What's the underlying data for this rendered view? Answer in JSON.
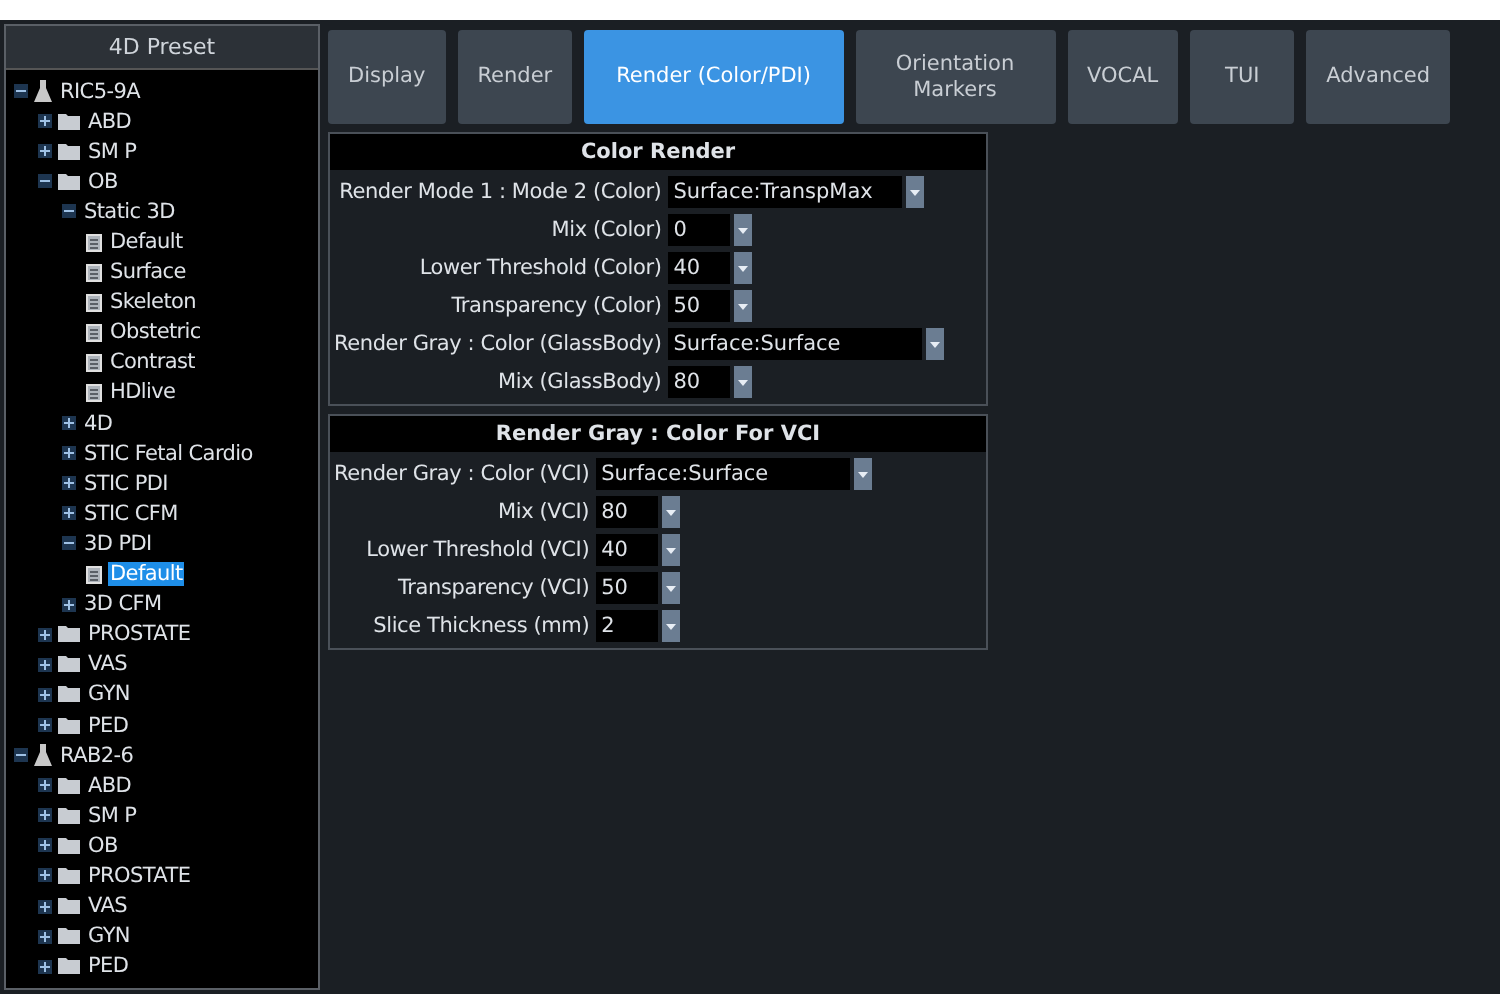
{
  "tree": {
    "title": "4D Preset",
    "items": [
      {
        "label": "RIC5-9A",
        "kind": "probe",
        "expanded": true,
        "selected": false,
        "children": [
          {
            "label": "ABD",
            "kind": "folder",
            "expanded": false,
            "selected": false
          },
          {
            "label": "SM P",
            "kind": "folder",
            "expanded": false,
            "selected": false
          },
          {
            "label": "OB",
            "kind": "folder",
            "expanded": true,
            "selected": false,
            "children": [
              {
                "label": "Static 3D",
                "kind": "mode",
                "expanded": true,
                "selected": false,
                "children": [
                  {
                    "label": "Default",
                    "kind": "preset",
                    "selected": false
                  },
                  {
                    "label": "Surface",
                    "kind": "preset",
                    "selected": false
                  },
                  {
                    "label": "Skeleton",
                    "kind": "preset",
                    "selected": false
                  },
                  {
                    "label": "Obstetric",
                    "kind": "preset",
                    "selected": false
                  },
                  {
                    "label": "Contrast",
                    "kind": "preset",
                    "selected": false
                  },
                  {
                    "label": "HDlive",
                    "kind": "preset",
                    "selected": false
                  }
                ]
              },
              {
                "label": "4D",
                "kind": "mode",
                "expanded": false,
                "selected": false
              },
              {
                "label": "STIC Fetal Cardio",
                "kind": "mode",
                "expanded": false,
                "selected": false
              },
              {
                "label": "STIC PDI",
                "kind": "mode",
                "expanded": false,
                "selected": false
              },
              {
                "label": "STIC CFM",
                "kind": "mode",
                "expanded": false,
                "selected": false
              },
              {
                "label": "3D PDI",
                "kind": "mode",
                "expanded": true,
                "selected": false,
                "children": [
                  {
                    "label": "Default",
                    "kind": "preset",
                    "selected": true
                  }
                ]
              },
              {
                "label": "3D CFM",
                "kind": "mode",
                "expanded": false,
                "selected": false
              }
            ]
          },
          {
            "label": "PROSTATE",
            "kind": "folder",
            "expanded": false,
            "selected": false
          },
          {
            "label": "VAS",
            "kind": "folder",
            "expanded": false,
            "selected": false
          },
          {
            "label": "GYN",
            "kind": "folder",
            "expanded": false,
            "selected": false
          },
          {
            "label": "PED",
            "kind": "folder",
            "expanded": false,
            "selected": false
          }
        ]
      },
      {
        "label": "RAB2-6",
        "kind": "probe",
        "expanded": true,
        "selected": false,
        "children": [
          {
            "label": "ABD",
            "kind": "folder",
            "expanded": false,
            "selected": false
          },
          {
            "label": "SM P",
            "kind": "folder",
            "expanded": false,
            "selected": false
          },
          {
            "label": "OB",
            "kind": "folder",
            "expanded": false,
            "selected": false
          },
          {
            "label": "PROSTATE",
            "kind": "folder",
            "expanded": false,
            "selected": false
          },
          {
            "label": "VAS",
            "kind": "folder",
            "expanded": false,
            "selected": false
          },
          {
            "label": "GYN",
            "kind": "folder",
            "expanded": false,
            "selected": false
          },
          {
            "label": "PED",
            "kind": "folder",
            "expanded": false,
            "selected": false
          }
        ]
      }
    ]
  },
  "tabs": [
    {
      "label": "Display",
      "selected": false
    },
    {
      "label": "Render",
      "selected": false
    },
    {
      "label": "Render (Color/PDI)",
      "selected": true
    },
    {
      "label": "Orientation Markers",
      "selected": false
    },
    {
      "label": "VOCAL",
      "selected": false
    },
    {
      "label": "TUI",
      "selected": false
    },
    {
      "label": "Advanced",
      "selected": false
    }
  ],
  "sections": [
    {
      "title": "Color Render",
      "rows": [
        {
          "label": "Render Mode 1 : Mode 2 (Color)",
          "value": "Surface:TranspMax",
          "kind": "medium"
        },
        {
          "label": "Mix (Color)",
          "value": "0",
          "kind": "narrow"
        },
        {
          "label": "Lower Threshold (Color)",
          "value": "40",
          "kind": "narrow"
        },
        {
          "label": "Transparency (Color)",
          "value": "50",
          "kind": "narrow"
        },
        {
          "label": "Render Gray : Color (GlassBody)",
          "value": "Surface:Surface",
          "kind": "wide"
        },
        {
          "label": "Mix (GlassBody)",
          "value": "80",
          "kind": "narrow"
        }
      ]
    },
    {
      "title": "Render Gray : Color For VCI",
      "rows": [
        {
          "label": "Render Gray : Color (VCI)",
          "value": "Surface:Surface",
          "kind": "wide"
        },
        {
          "label": "Mix (VCI)",
          "value": "80",
          "kind": "narrow"
        },
        {
          "label": "Lower Threshold (VCI)",
          "value": "40",
          "kind": "narrow"
        },
        {
          "label": "Transparency (VCI)",
          "value": "50",
          "kind": "narrow"
        },
        {
          "label": "Slice Thickness (mm)",
          "value": "2",
          "kind": "narrow"
        }
      ]
    }
  ]
}
